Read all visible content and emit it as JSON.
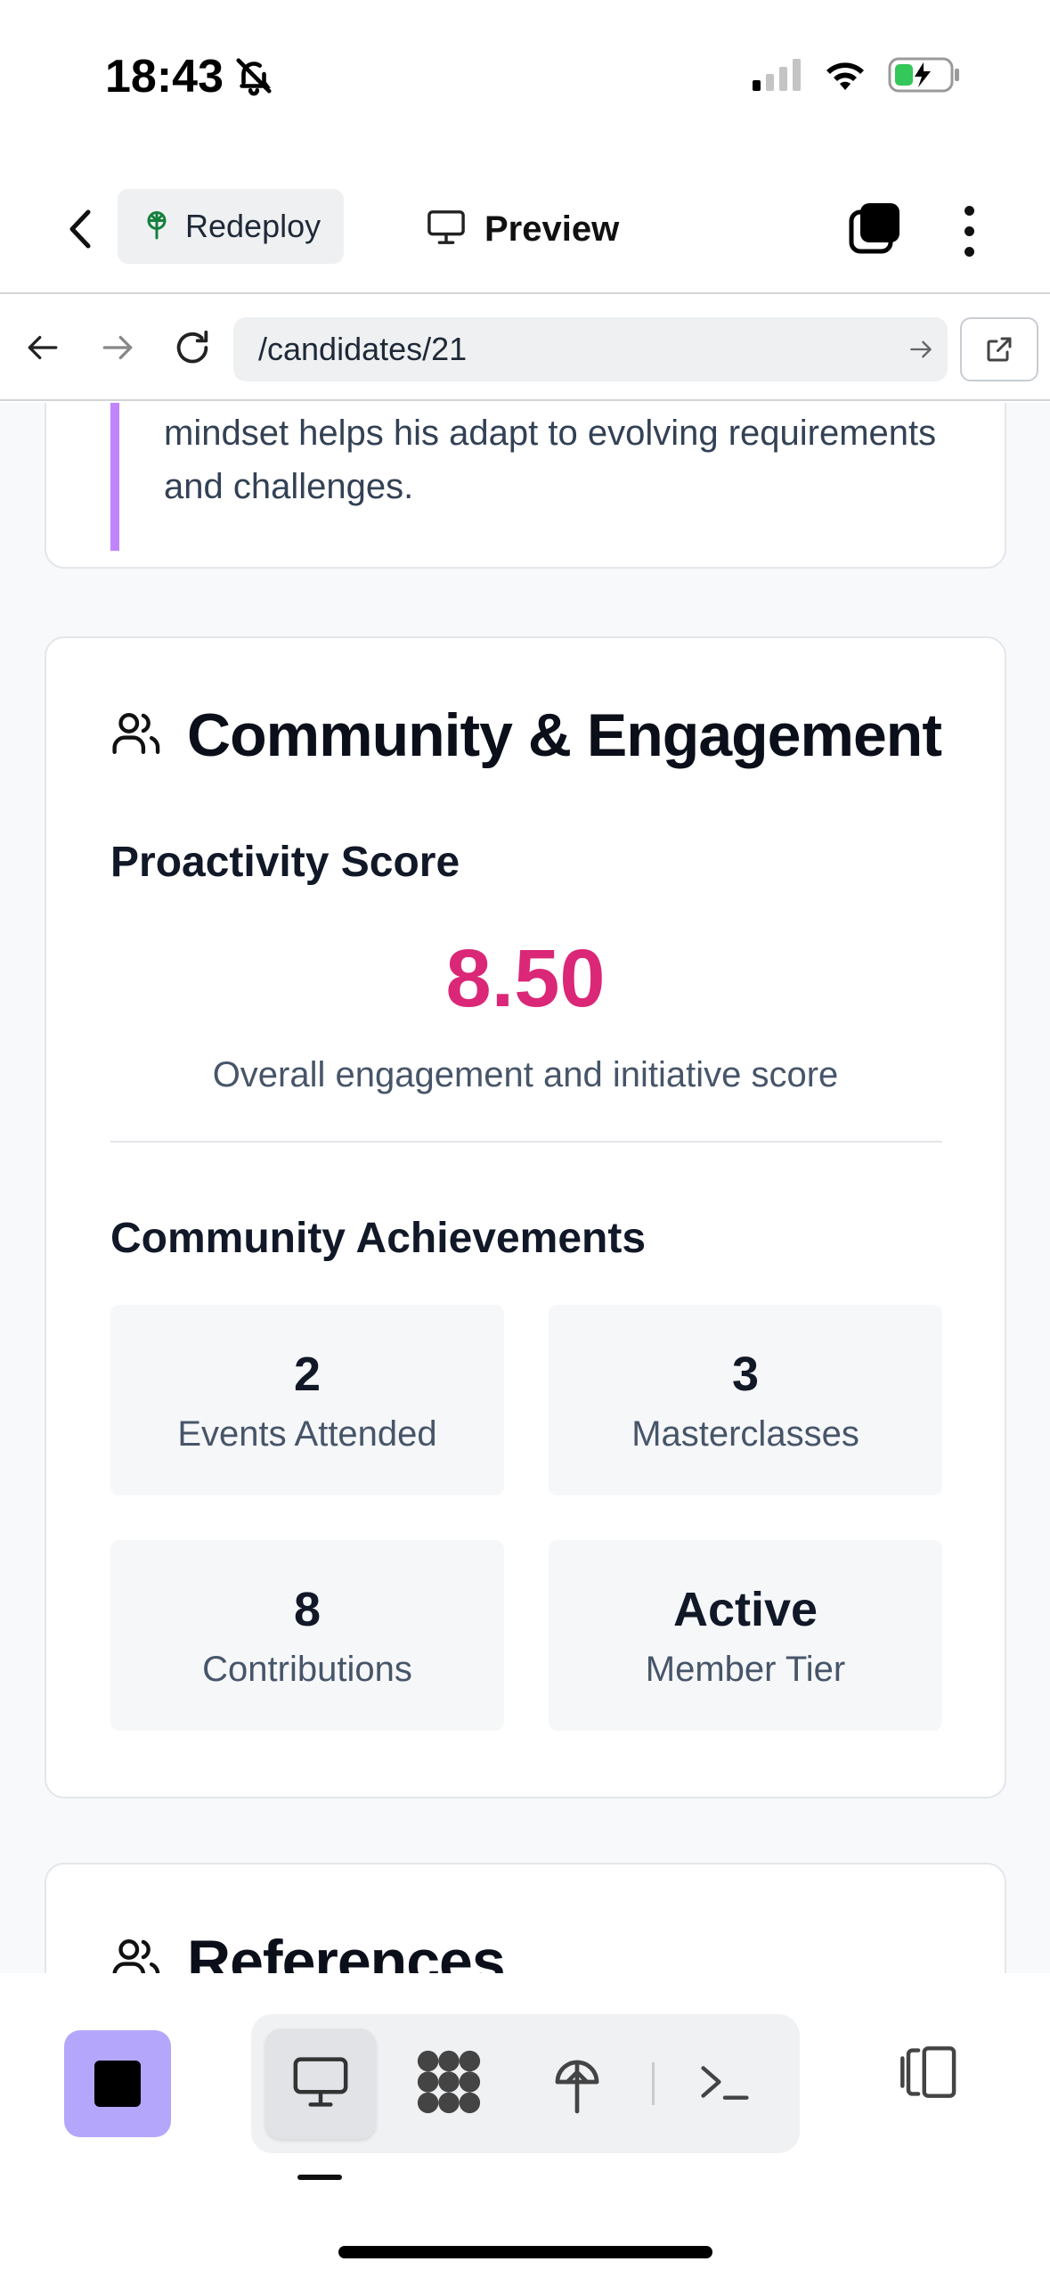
{
  "status_bar": {
    "time": "18:43"
  },
  "toolbar": {
    "redeploy_label": "Redeploy",
    "preview_label": "Preview"
  },
  "browser": {
    "url": "/candidates/21"
  },
  "intro_card": {
    "text": "mindset helps his adapt to evolving requirements and challenges."
  },
  "community": {
    "title": "Community & Engagement",
    "proactivity_heading": "Proactivity Score",
    "score": "8.50",
    "score_caption": "Overall engagement and initiative score",
    "achievements_heading": "Community Achievements",
    "achievements": [
      {
        "value": "2",
        "label": "Events Attended"
      },
      {
        "value": "3",
        "label": "Masterclasses"
      },
      {
        "value": "8",
        "label": "Contributions"
      },
      {
        "value": "Active",
        "label": "Member Tier"
      }
    ]
  },
  "references": {
    "title": "References"
  },
  "colors": {
    "accent": "#db2777",
    "quote_bar": "#c084fc",
    "stop_button": "#b4a7fb"
  },
  "icons": {
    "status": [
      "bell-slash-icon",
      "cellular-signal-icon",
      "wifi-icon",
      "battery-charging-icon"
    ],
    "toolbar": [
      "chevron-left-icon",
      "tree-icon",
      "monitor-icon",
      "tabs-icon",
      "more-vertical-icon"
    ],
    "browser": [
      "arrow-left-icon",
      "arrow-right-icon",
      "reload-icon",
      "arrow-go-icon",
      "external-link-icon"
    ],
    "bottom": [
      "stop-icon",
      "monitor-icon",
      "grid-blobs-icon",
      "deploy-tree-icon",
      "terminal-icon",
      "panel-layout-icon"
    ]
  }
}
